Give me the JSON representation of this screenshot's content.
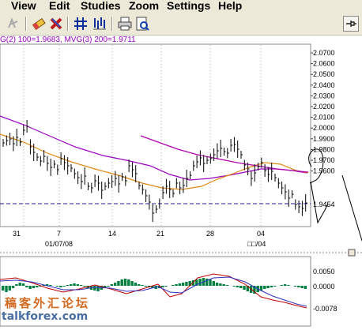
{
  "menu": {
    "items": [
      "View",
      "Edit",
      "Studies",
      "Zoom",
      "Settings",
      "Help"
    ]
  },
  "toolbar": {
    "buttons": [
      "lock-icon",
      "eraser-icon",
      "delete-icon",
      "crosshair-icon",
      "studies-icon",
      "print-icon",
      "print-preview-icon",
      "pin-icon"
    ]
  },
  "legend": {
    "text": "G(2) 100=1.9683, MVG(3) 200=1.9711"
  },
  "price_axis": {
    "labels": [
      "2.0700",
      "2.0600",
      "2.0500",
      "2.0400",
      "2.0300",
      "2.0200",
      "2.0100",
      "2.0000",
      "1.9900",
      "1.9800",
      "1.9700",
      "1.9600"
    ],
    "current": "1.9454"
  },
  "date_axis": {
    "days": [
      "31",
      "7",
      "14",
      "21",
      "28",
      "04"
    ],
    "months": [
      "01/07/08",
      "□□/04"
    ]
  },
  "macd_axis": {
    "labels": [
      "0.0050",
      "0.0000",
      "-0.0078"
    ]
  },
  "watermark": {
    "line1": "稿客外汇论坛",
    "line2": "talkforex.com"
  },
  "colors": {
    "ma100": "#9a00c0",
    "ma200": "#e08a10",
    "bars": "#000000",
    "histogram": "#008040",
    "support": "#1a1a8c",
    "macd_line": "#c00000",
    "signal_line": "#3030c0"
  },
  "chart_data": {
    "type": "line",
    "series": [
      {
        "name": "G(2) 100",
        "last": 1.9683
      },
      {
        "name": "MVG(3) 200",
        "last": 1.9711
      }
    ],
    "support_level": 1.9454,
    "ylim": [
      1.94,
      2.075
    ]
  }
}
